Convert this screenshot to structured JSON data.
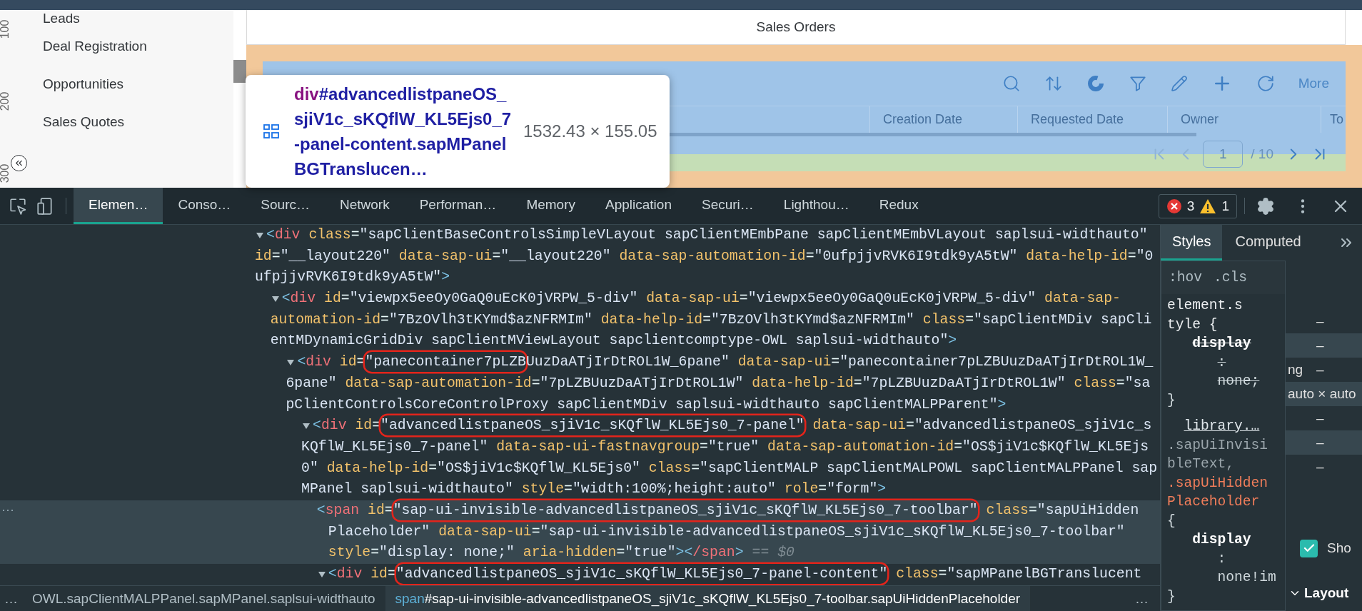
{
  "app": {
    "sidebar": {
      "items": [
        {
          "label": "Leads"
        },
        {
          "label": "Deal Registration"
        },
        {
          "label": "Opportunities"
        },
        {
          "label": "Sales Quotes"
        }
      ]
    },
    "ruler_labels": [
      "100",
      "200",
      "300"
    ],
    "page_title": "Sales Orders",
    "panel": {
      "more_label": "More",
      "columns": [
        "Creation Date",
        "Requested Date",
        "Owner",
        "To"
      ],
      "pagination": {
        "buttons_before": [
          {
            "kind": "first",
            "disabled": true
          },
          {
            "kind": "prev",
            "disabled": true
          }
        ],
        "page": "1",
        "total": "/ 10",
        "buttons_after": [
          {
            "kind": "next",
            "disabled": false
          },
          {
            "kind": "last",
            "disabled": false
          }
        ]
      }
    }
  },
  "tooltip": {
    "tag": "div",
    "selector": "#advancedlistpaneOS_sjiV1c_sKQflW_KL5Ejs0_7-panel-content.sapMPanelBGTranslucen…",
    "size": "1532.43 × 155.05"
  },
  "devtools": {
    "tabs": [
      {
        "label": "Elemen…",
        "selected": true
      },
      {
        "label": "Conso…",
        "selected": false
      },
      {
        "label": "Sourc…",
        "selected": false
      },
      {
        "label": "Network",
        "selected": false
      },
      {
        "label": "Performan…",
        "selected": false
      },
      {
        "label": "Memory",
        "selected": false
      },
      {
        "label": "Application",
        "selected": false
      },
      {
        "label": "Securi…",
        "selected": false
      },
      {
        "label": "Lighthou…",
        "selected": false
      },
      {
        "label": "Redux",
        "selected": false
      }
    ],
    "issues": {
      "errors": "3",
      "warnings": "1"
    },
    "dom_tree": [
      {
        "kind": "parent",
        "expanded": true,
        "selected": false,
        "lines": [
          [
            {
              "text": "<div class=\"sapClientBaseControlsSimpleVLayout sapClientMEmbPane sapClientMEmbVLayout saplsui-widthauto\"",
              "circled": false
            }
          ],
          [
            {
              "text": "id=\"__layout220\" data-sap-ui=\"__layout220\" data-sap-automation-id=\"0ufpjjvRVK6I9tdk9yA5tW\" data-help-id=\"0",
              "circled": false
            }
          ],
          [
            {
              "text": "ufpjjvRVK6I9tdk9yA5tW\">",
              "circled": false
            }
          ]
        ],
        "children": [
          {
            "kind": "parent",
            "expanded": true,
            "selected": false,
            "lines": [
              [
                {
                  "text": "<div id=\"viewpx5eeOy0GaQ0uEcK0jVRPW_5-div\" data-sap-ui=\"viewpx5eeOy0GaQ0uEcK0jVRPW_5-div\" data-sap-",
                  "circled": false
                }
              ],
              [
                {
                  "text": "automation-id=\"7BzOVlh3tKYmd$azNFRMIm\" data-help-id=\"7BzOVlh3tKYmd$azNFRMIm\" class=\"sapClientMDiv sapCli",
                  "circled": false
                }
              ],
              [
                {
                  "text": "entMDynamicGridDiv sapClientMViewLayout sapclientcomptype-OWL saplsui-widthauto\">",
                  "circled": false
                }
              ]
            ],
            "children": [
              {
                "kind": "parent",
                "expanded": true,
                "selected": false,
                "lines": [
                  [
                    {
                      "text": "<div id=",
                      "circled": false
                    },
                    {
                      "text": "\"panecontainer7pLZB",
                      "circled": true
                    },
                    {
                      "text": "UuzDaATjIrDtROL1W_6pane\" data-sap-ui=\"panecontainer7pLZBUuzDaATjIrDtROL1W_",
                      "circled": false
                    }
                  ],
                  [
                    {
                      "text": "6pane\" data-sap-automation-id=\"7pLZBUuzDaATjIrDtROL1W\" data-help-id=\"7pLZBUuzDaATjIrDtROL1W\" class=\"sa",
                      "circled": false
                    }
                  ],
                  [
                    {
                      "text": "pClientControlsCoreControlProxy sapClientMDiv saplsui-widthauto sapClientMALPParent\">",
                      "circled": false
                    }
                  ]
                ],
                "children": [
                  {
                    "kind": "parent",
                    "expanded": true,
                    "selected": false,
                    "lines": [
                      [
                        {
                          "text": "<div id=",
                          "circled": false
                        },
                        {
                          "text": "\"advancedlistpaneOS_sjiV1c_sKQflW_KL5Ejs0_7-panel\"",
                          "circled": true
                        },
                        {
                          "text": " data-sap-ui=\"advancedlistpaneOS_sjiV1c_s",
                          "circled": false
                        }
                      ],
                      [
                        {
                          "text": "KQflW_KL5Ejs0_7-panel\" data-sap-ui-fastnavgroup=\"true\" data-sap-automation-id=\"OS$jiV1c$KQflW_KL5Ejs",
                          "circled": false
                        }
                      ],
                      [
                        {
                          "text": "0\" data-help-id=\"OS$jiV1c$KQflW_KL5Ejs0\" class=\"sapClientMALP sapClientMALPOWL sapClientMALPPanel sap",
                          "circled": false
                        }
                      ],
                      [
                        {
                          "text": "MPanel saplsui-widthauto\" style=\"width:100%;height:auto\" role=\"form\">",
                          "circled": false
                        }
                      ]
                    ],
                    "children": [
                      {
                        "kind": "leaf",
                        "selected": true,
                        "menu_button": "⋯",
                        "console_ref": "== $0",
                        "lines": [
                          [
                            {
                              "text": "<span id=",
                              "circled": false
                            },
                            {
                              "text": "\"sap-ui-invisible-advancedlistpaneOS_sjiV1c_sKQflW_KL5Ejs0_7-toolbar\"",
                              "circled": true
                            },
                            {
                              "text": " class=\"sapUiHidden",
                              "circled": false
                            }
                          ],
                          [
                            {
                              "text": "Placeholder\" data-sap-ui=\"sap-ui-invisible-advancedlistpaneOS_sjiV1c_sKQflW_KL5Ejs0_7-toolbar\"",
                              "circled": false
                            }
                          ],
                          [
                            {
                              "text": "style=\"display: none;\" aria-hidden=\"true\"></span>",
                              "circled": false
                            }
                          ]
                        ]
                      },
                      {
                        "kind": "parent",
                        "expanded": true,
                        "selected": false,
                        "lines": [
                          [
                            {
                              "text": "<div id=",
                              "circled": false
                            },
                            {
                              "text": "\"advancedlistpaneOS_sjiV1c_sKQflW_KL5Ejs0_7-panel-content\"",
                              "circled": true
                            },
                            {
                              "text": " class=\"sapMPanelBGTranslucent",
                              "circled": false
                            }
                          ]
                        ]
                      }
                    ]
                  }
                ]
              }
            ]
          }
        ]
      }
    ],
    "breadcrumbs": {
      "overflow_left": "…",
      "overflow_right": "…",
      "items": [
        {
          "text": "OWL.sapClientMALPPanel.sapMPanel.saplsui-widthauto",
          "selected": false
        },
        {
          "tag": "span",
          "text": "#sap-ui-invisible-advancedlistpaneOS_sjiV1c_sKQflW_KL5Ejs0_7-toolbar.sapUiHiddenPlaceholder",
          "selected": true
        }
      ]
    },
    "styles_pane": {
      "tabs": [
        {
          "label": "Styles",
          "selected": true
        },
        {
          "label": "Computed",
          "selected": false
        }
      ],
      "filter_buttons": [
        ":hov",
        ".cls"
      ],
      "rule_lines": [
        {
          "kind": "selector",
          "text": "element.s",
          "struck": false
        },
        {
          "kind": "selector",
          "text": "tyle {",
          "struck": false
        },
        {
          "kind": "property",
          "text": "display",
          "struck": true
        },
        {
          "kind": "separator",
          "text": ":",
          "struck": true
        },
        {
          "kind": "value",
          "text": "none;",
          "struck": true
        },
        {
          "kind": "brace",
          "text": "}",
          "struck": false
        },
        {
          "kind": "link",
          "text": "library.…",
          "struck": false
        },
        {
          "kind": "inactive",
          "text": ".sapUiInvisi",
          "struck": false
        },
        {
          "kind": "inactive",
          "text": "bleText,",
          "struck": false
        },
        {
          "kind": "matched",
          "text": ".sapUiHidden",
          "struck": false
        },
        {
          "kind": "matched",
          "text": "Placeholder",
          "struck": false
        },
        {
          "kind": "brace",
          "text": "{",
          "struck": false
        },
        {
          "kind": "property",
          "text": "display",
          "struck": false
        },
        {
          "kind": "separator",
          "text": ":",
          "struck": false
        },
        {
          "kind": "value",
          "text": "none!im",
          "struck": false
        },
        {
          "kind": "brace",
          "text": "}",
          "struck": false
        }
      ],
      "box_rows": [
        {
          "value": "–"
        },
        {
          "value": "–"
        },
        {
          "label": "ng",
          "value": "–"
        },
        {
          "dimensions": "auto × auto"
        },
        {
          "value": "–"
        },
        {
          "value": "–"
        },
        {
          "value": "–"
        }
      ],
      "show_all": {
        "label": "Sho",
        "checked": true
      },
      "layout_section": {
        "label": "Layout",
        "expanded": true
      }
    }
  }
}
